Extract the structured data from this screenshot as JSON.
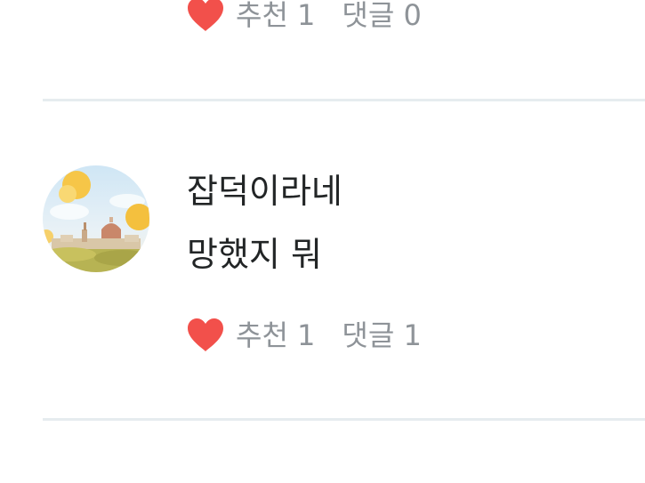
{
  "previous_item": {
    "likes_label": "추천 1",
    "replies_label": "댓글 0"
  },
  "comment": {
    "nickname": "잡덕이라네",
    "body": "망했지 뭐",
    "likes_label": "추천 1",
    "replies_label": "댓글 1",
    "avatar_icon": "avatar-florence-cathedral-image"
  },
  "colors": {
    "heart": "#f2504b",
    "meta_text": "#8e9398",
    "primary_text": "#222526",
    "divider": "#e6ecef"
  }
}
